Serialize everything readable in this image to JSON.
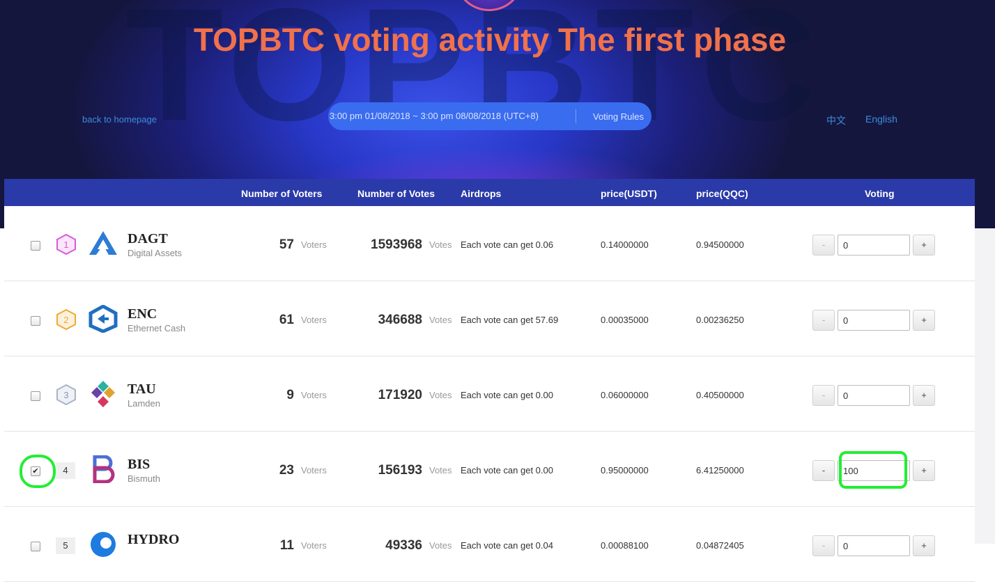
{
  "hero": {
    "bg_text": "TOPBTC",
    "title": "TOPBTC voting activity The first phase",
    "back_link": "back to homepage",
    "time_range": "3:00 pm 01/08/2018 ~ 3:00 pm 08/08/2018 (UTC+8)",
    "rules_link": "Voting Rules",
    "lang_zh": "中文",
    "lang_en": "English"
  },
  "table": {
    "headers": {
      "voters": "Number of Voters",
      "votes": "Number of Votes",
      "airdrops": "Airdrops",
      "price_usdt": "price(USDT)",
      "price_qqc": "price(QQC)",
      "voting": "Voting"
    },
    "minus_label": "-",
    "plus_label": "+",
    "voters_unit": "Voters",
    "votes_unit": "Votes",
    "rows": [
      {
        "rank": "1",
        "symbol": "DAGT",
        "name": "Digital Assets",
        "voters": "57",
        "votes": "1593968",
        "airdrop": "Each vote can get 0.06",
        "price_usdt": "0.14000000",
        "price_qqc": "0.94500000",
        "vote_value": "0",
        "checked": false
      },
      {
        "rank": "2",
        "symbol": "ENC",
        "name": "Ethernet Cash",
        "voters": "61",
        "votes": "346688",
        "airdrop": "Each vote can get 57.69",
        "price_usdt": "0.00035000",
        "price_qqc": "0.00236250",
        "vote_value": "0",
        "checked": false
      },
      {
        "rank": "3",
        "symbol": "TAU",
        "name": "Lamden",
        "voters": "9",
        "votes": "171920",
        "airdrop": "Each vote can get 0.00",
        "price_usdt": "0.06000000",
        "price_qqc": "0.40500000",
        "vote_value": "0",
        "checked": false
      },
      {
        "rank": "4",
        "symbol": "BIS",
        "name": "Bismuth",
        "voters": "23",
        "votes": "156193",
        "airdrop": "Each vote can get 0.00",
        "price_usdt": "0.95000000",
        "price_qqc": "6.41250000",
        "vote_value": "100",
        "checked": true
      },
      {
        "rank": "5",
        "symbol": "HYDRO",
        "name": "",
        "voters": "11",
        "votes": "49336",
        "airdrop": "Each vote can get 0.04",
        "price_usdt": "0.00088100",
        "price_qqc": "0.04872405",
        "vote_value": "0",
        "checked": false
      }
    ]
  },
  "colors": {
    "title": "#f0714b",
    "header_bg": "#2a3aa8",
    "link": "#3c8dde",
    "highlight": "#22ee33",
    "rank1": "#d85ad8",
    "rank2": "#f2a830",
    "rank3": "#a9b4c8"
  },
  "icons": {
    "checkmark": "✔",
    "rank_badge": "hexagon-badge-icon"
  }
}
